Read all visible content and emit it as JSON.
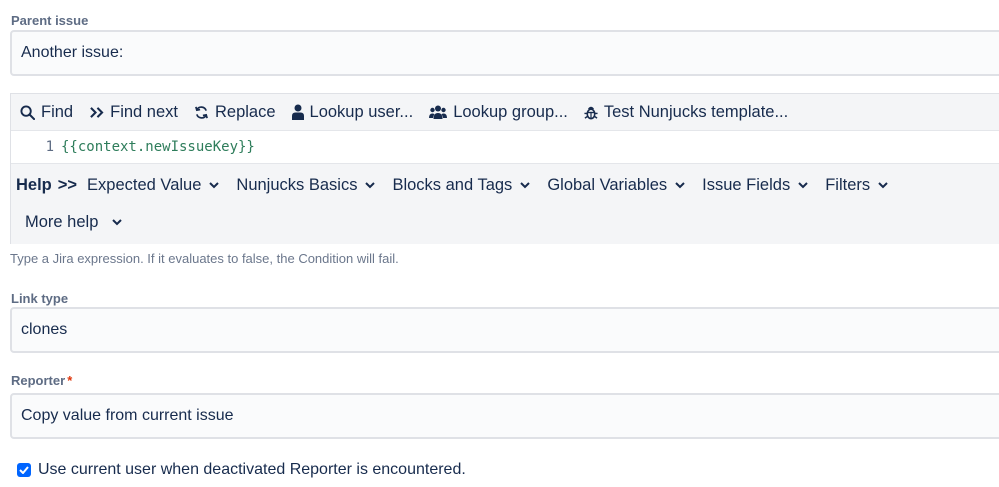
{
  "parent_issue": {
    "label": "Parent issue",
    "value": "Another issue:"
  },
  "editor": {
    "toolbar": {
      "find": "Find",
      "find_next": "Find next",
      "replace": "Replace",
      "lookup_user": "Lookup user...",
      "lookup_group": "Lookup group...",
      "test_template": "Test Nunjucks template..."
    },
    "line_number": "1",
    "code": "{{context.newIssueKey}}",
    "help": {
      "title": "Help",
      "arrow": ">>",
      "items": [
        "Expected Value",
        "Nunjucks Basics",
        "Blocks and Tags",
        "Global Variables",
        "Issue Fields",
        "Filters"
      ],
      "more": "More help"
    }
  },
  "hint": "Type a Jira expression. If it evaluates to false, the Condition will fail.",
  "link_type": {
    "label": "Link type",
    "value": "clones"
  },
  "reporter": {
    "label": "Reporter",
    "required_mark": "*",
    "value": "Copy value from current issue"
  },
  "deactivated_option": {
    "checked": true,
    "label": "Use current user when deactivated Reporter is encountered."
  },
  "colors": {
    "accent": "#0065ff",
    "required": "#de350b",
    "code": "#2e7d5b"
  }
}
